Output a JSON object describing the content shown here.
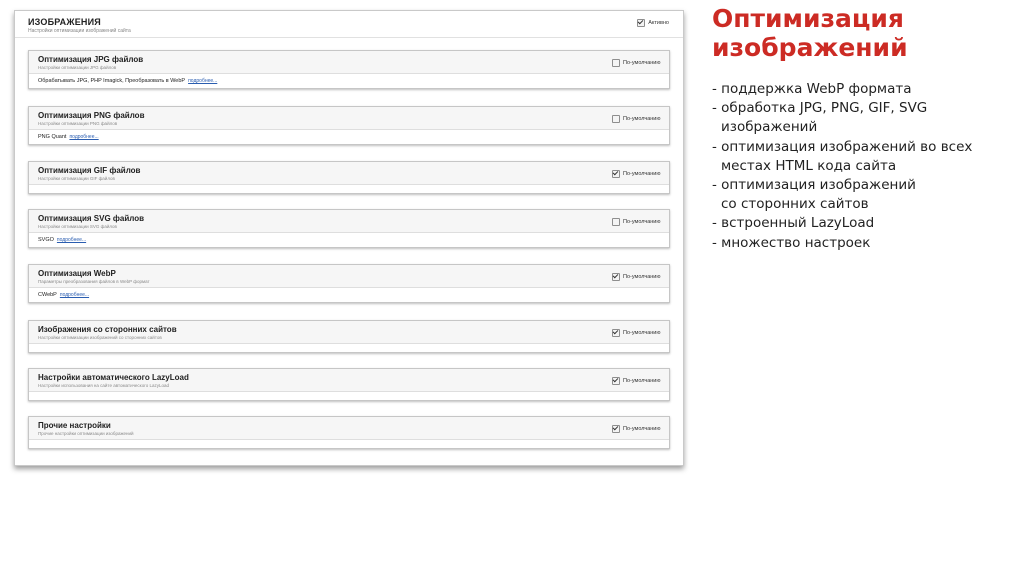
{
  "panel": {
    "title": "ИЗОБРАЖЕНИЯ",
    "subtitle": "Настройки оптимизации изображений сайта",
    "active_label": "Активно",
    "active_checked": true
  },
  "sections": [
    {
      "title": "Оптимизация JPG файлов",
      "subtitle": "Настройки оптимизации JPG файлов",
      "default_label": "По-умолчанию",
      "default_checked": false,
      "body_text": "Обрабатывать JPG, PHP Imagick, Преобразовать в WebP",
      "link": "подробнее..."
    },
    {
      "title": "Оптимизация PNG файлов",
      "subtitle": "Настройки оптимизации PNG файлов",
      "default_label": "По-умолчанию",
      "default_checked": false,
      "body_text": "PNG Quant",
      "link": "подробнее..."
    },
    {
      "title": "Оптимизация GIF файлов",
      "subtitle": "Настройки оптимизации GIF файлов",
      "default_label": "По-умолчанию",
      "default_checked": true,
      "body_text": "",
      "link": ""
    },
    {
      "title": "Оптимизация SVG файлов",
      "subtitle": "Настройки оптимизации SVG файлов",
      "default_label": "По-умолчанию",
      "default_checked": false,
      "body_text": "SVGO",
      "link": "подробнее..."
    },
    {
      "title": "Оптимизация WebP",
      "subtitle": "Параметры преобразования файлов в WebP формат",
      "default_label": "По-умолчанию",
      "default_checked": true,
      "body_text": "CWebP",
      "link": "подробнее..."
    },
    {
      "title": "Изображения со сторонних сайтов",
      "subtitle": "Настройки оптимизации изображений со сторонних сайтов",
      "default_label": "По-умолчанию",
      "default_checked": true,
      "body_text": "",
      "link": ""
    },
    {
      "title": "Настройки автоматического LazyLoad",
      "subtitle": "Настройки использования на сайте автоматического LazyLoad",
      "default_label": "По-умолчанию",
      "default_checked": true,
      "body_text": "",
      "link": ""
    },
    {
      "title": "Прочие настройки",
      "subtitle": "Прочие настройки оптимизации изображений",
      "default_label": "По-умолчанию",
      "default_checked": true,
      "body_text": "",
      "link": ""
    }
  ],
  "slide": {
    "title": "Оптимизация изображений",
    "features": [
      "- поддержка WebP формата",
      "- обработка JPG, PNG, GIF, SVG\nизображений",
      "- оптимизация изображений во всех\nместах HTML кода сайта",
      "- оптимизация изображений\nсо сторонних сайтов",
      "- встроенный LazyLoad",
      "- множество настроек"
    ]
  },
  "colors": {
    "accent_title": "#cc2b24",
    "link": "#2a5db0"
  }
}
